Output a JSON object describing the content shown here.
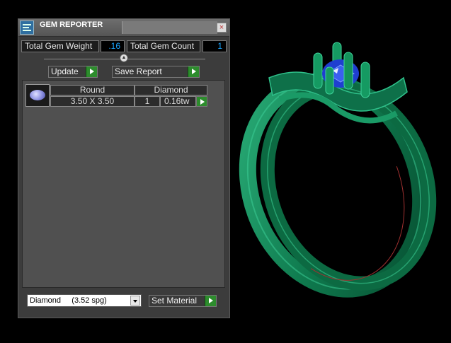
{
  "window": {
    "title": "GEM REPORTER",
    "close_symbol": "×"
  },
  "stats": {
    "total_weight_label": "Total Gem Weight",
    "total_weight_value": ".16",
    "total_count_label": "Total Gem Count",
    "total_count_value": "1"
  },
  "actions": {
    "update_label": "Update",
    "save_report_label": "Save Report"
  },
  "gems": [
    {
      "shape": "Round",
      "material": "Diamond",
      "size": "3.50 X 3.50",
      "count": "1",
      "weight": "0.16tw"
    }
  ],
  "material_select": {
    "value": "Diamond     (3.52 spg)"
  },
  "set_material_label": "Set Material",
  "colors": {
    "ring_green": "#0f7a4e",
    "gem_blue": "#1f3fd0",
    "accent_value": "#19a5ff",
    "button_green": "#2d8c2d"
  }
}
